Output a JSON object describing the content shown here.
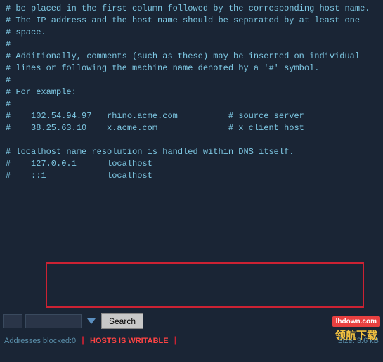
{
  "editor": {
    "lines": [
      "# be placed in the first column followed by the corresponding host name.",
      "# The IP address and the host name should be separated by at least one",
      "# space.",
      "#",
      "# Additionally, comments (such as these) may be inserted on individual",
      "# lines or following the machine name denoted by a '#' symbol.",
      "#",
      "# For example:",
      "#",
      "#    102.54.94.97   rhino.acme.com          # source server",
      "#    38.25.63.10    x.acme.com              # x client host",
      "",
      "# localhost name resolution is handled within DNS itself.",
      "#    127.0.0.1      localhost",
      "#    ::1            localhost"
    ]
  },
  "toolbar": {
    "search_label": "Search",
    "search_placeholder": "",
    "left_field_placeholder": "",
    "mid_field_placeholder": ""
  },
  "status": {
    "addresses_label": "Addresses blocked:",
    "addresses_count": "0",
    "divider1": "|",
    "hosts_writable": "HOSTS IS WRITABLE",
    "divider2": "|",
    "size_label": "Size: 3.6 kB"
  },
  "watermark": {
    "cn_text": "领航下载",
    "url_text": "lhdown.com"
  }
}
